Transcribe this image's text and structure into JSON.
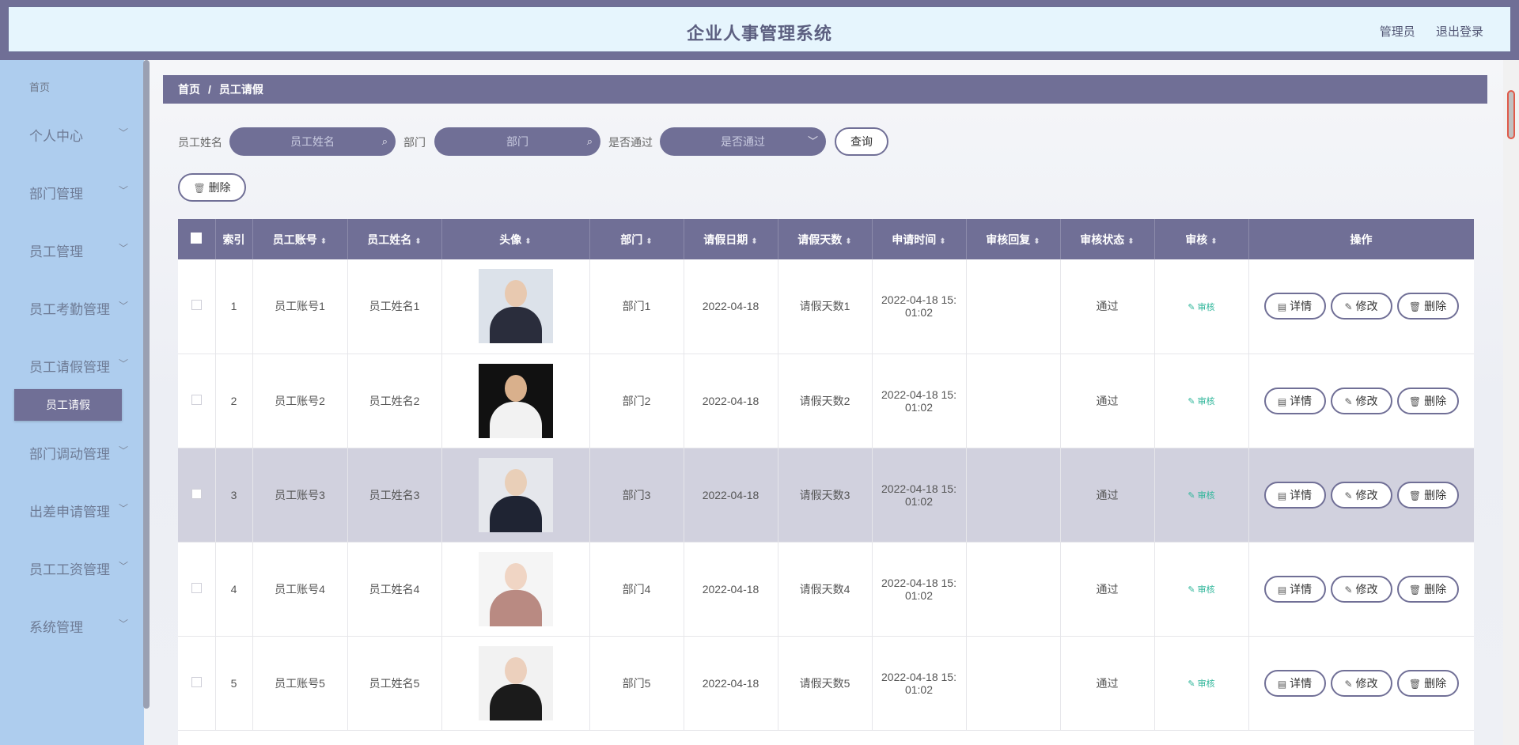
{
  "header": {
    "title": "企业人事管理系统",
    "user": "管理员",
    "logout": "退出登录"
  },
  "sidebar": {
    "home": "首页",
    "items": [
      {
        "label": "个人中心"
      },
      {
        "label": "部门管理"
      },
      {
        "label": "员工管理"
      },
      {
        "label": "员工考勤管理"
      },
      {
        "label": "员工请假管理"
      },
      {
        "label": "部门调动管理"
      },
      {
        "label": "出差申请管理"
      },
      {
        "label": "员工工资管理"
      },
      {
        "label": "系统管理"
      }
    ],
    "active_sub": "员工请假"
  },
  "breadcrumb": {
    "home": "首页",
    "current": "员工请假"
  },
  "search": {
    "name_label": "员工姓名",
    "name_placeholder": "员工姓名",
    "dept_label": "部门",
    "dept_placeholder": "部门",
    "pass_label": "是否通过",
    "pass_placeholder": "是否通过",
    "query": "查询",
    "delete": "删除"
  },
  "table": {
    "columns": [
      "索引",
      "员工账号",
      "员工姓名",
      "头像",
      "部门",
      "请假日期",
      "请假天数",
      "申请时间",
      "审核回复",
      "审核状态",
      "审核",
      "操作"
    ],
    "rows": [
      {
        "idx": "1",
        "account": "员工账号1",
        "name": "员工姓名1",
        "dept": "部门1",
        "date": "2022-04-18",
        "days": "请假天数1",
        "apply1": "2022-04-18 15:",
        "apply2": "01:02",
        "reply": "",
        "status": "通过",
        "audit": "审核"
      },
      {
        "idx": "2",
        "account": "员工账号2",
        "name": "员工姓名2",
        "dept": "部门2",
        "date": "2022-04-18",
        "days": "请假天数2",
        "apply1": "2022-04-18 15:",
        "apply2": "01:02",
        "reply": "",
        "status": "通过",
        "audit": "审核"
      },
      {
        "idx": "3",
        "account": "员工账号3",
        "name": "员工姓名3",
        "dept": "部门3",
        "date": "2022-04-18",
        "days": "请假天数3",
        "apply1": "2022-04-18 15:",
        "apply2": "01:02",
        "reply": "",
        "status": "通过",
        "audit": "审核"
      },
      {
        "idx": "4",
        "account": "员工账号4",
        "name": "员工姓名4",
        "dept": "部门4",
        "date": "2022-04-18",
        "days": "请假天数4",
        "apply1": "2022-04-18 15:",
        "apply2": "01:02",
        "reply": "",
        "status": "通过",
        "audit": "审核"
      },
      {
        "idx": "5",
        "account": "员工账号5",
        "name": "员工姓名5",
        "dept": "部门5",
        "date": "2022-04-18",
        "days": "请假天数5",
        "apply1": "2022-04-18 15:",
        "apply2": "01:02",
        "reply": "",
        "status": "通过",
        "audit": "审核"
      }
    ],
    "actions": {
      "detail": "详情",
      "edit": "修改",
      "delete": "删除"
    }
  },
  "colors": {
    "accent": "#706f96",
    "sidebar": "#aecdee",
    "audit": "#2fb69a"
  }
}
